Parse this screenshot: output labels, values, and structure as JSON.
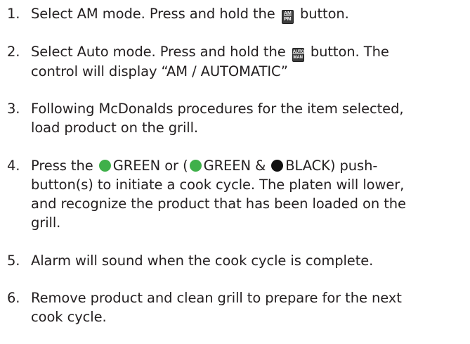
{
  "colors": {
    "text": "#231f20",
    "green_button": "#3fb04a",
    "black_button": "#111111",
    "key_icon": "#3d3d3d"
  },
  "icons": {
    "am_pm": "am-pm-button-icon",
    "auto_man": "auto-man-button-icon",
    "green": "green-button-icon",
    "black": "black-button-icon"
  },
  "steps": [
    {
      "number": "1.",
      "pre": "Select AM mode.  Press and hold the",
      "icon_top": "AM",
      "icon_bottom": "PM",
      "post": "button."
    },
    {
      "number": "2.",
      "pre": "Select Auto mode.  Press and hold the",
      "icon_top": "AUTO",
      "icon_bottom": "MAN",
      "post": "button. The",
      "line2": "control will display “AM / AUTOMATIC”"
    },
    {
      "number": "3.",
      "line1": "Following McDonalds procedures for the item selected,",
      "line2": "load product on the grill."
    },
    {
      "number": "4.",
      "pre": "Press the",
      "green1": "GREEN or (",
      "green2": "GREEN &",
      "black": "BLACK) push-",
      "line2": "button(s) to initiate a cook cycle. The platen will lower,",
      "line3": "and recognize the product that has been loaded on the",
      "line4": "grill."
    },
    {
      "number": "5.",
      "line1": "Alarm will sound when the cook cycle is complete."
    },
    {
      "number": "6.",
      "line1": "Remove product and clean grill to prepare for the next",
      "line2": "cook cycle."
    }
  ]
}
